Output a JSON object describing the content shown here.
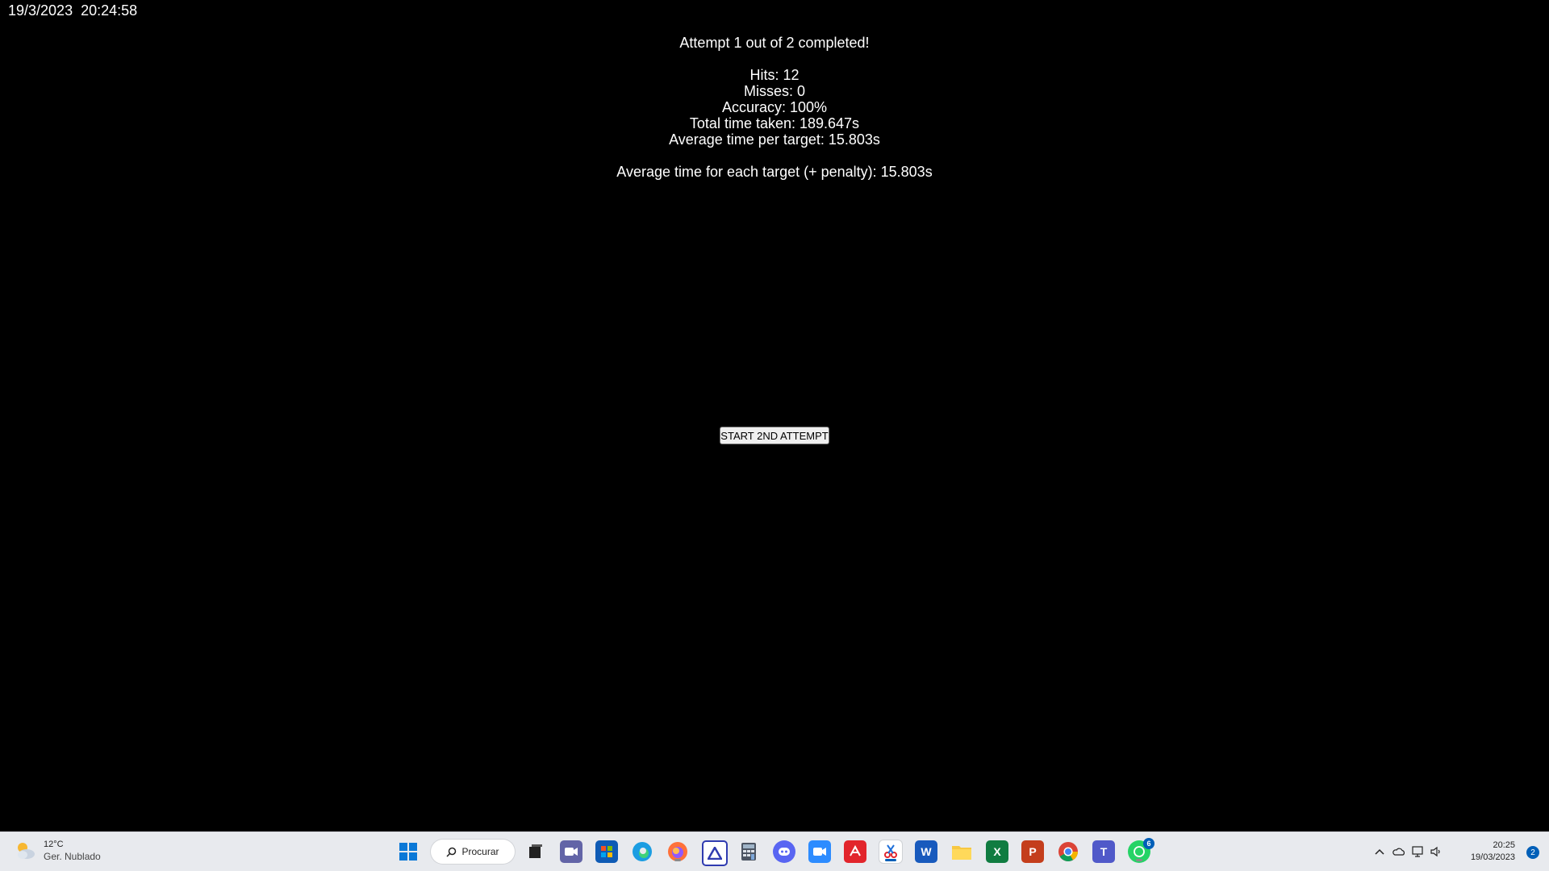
{
  "clock": "19/3/2023  20:24:58",
  "results": {
    "title": "Attempt 1 out of 2 completed!",
    "hits": "Hits: 12",
    "misses": "Misses: 0",
    "accuracy": "Accuracy: 100%",
    "total_time": "Total time taken: 189.647s",
    "avg_time": "Average time per target: 15.803s",
    "avg_penalty": "Average time for each target (+ penalty): 15.803s"
  },
  "button": {
    "label": "START 2ND ATTEMPT"
  },
  "taskbar": {
    "weather": {
      "temp": "12°C",
      "desc": "Ger. Nublado"
    },
    "search_label": "Procurar",
    "whatsapp_badge": "6",
    "time": "20:25",
    "date": "19/03/2023",
    "notifications": "2",
    "apps": [
      {
        "name": "start-icon"
      },
      {
        "name": "task-view-icon"
      },
      {
        "name": "chat-icon"
      },
      {
        "name": "store-icon"
      },
      {
        "name": "edge-icon"
      },
      {
        "name": "firefox-icon"
      },
      {
        "name": "azure-data-studio-icon"
      },
      {
        "name": "calculator-icon"
      },
      {
        "name": "discord-icon"
      },
      {
        "name": "zoom-icon"
      },
      {
        "name": "acrobat-icon"
      },
      {
        "name": "snipping-tool-icon"
      },
      {
        "name": "word-icon"
      },
      {
        "name": "file-explorer-icon"
      },
      {
        "name": "excel-icon"
      },
      {
        "name": "powerpoint-icon"
      },
      {
        "name": "chrome-icon"
      },
      {
        "name": "teams-icon"
      },
      {
        "name": "whatsapp-icon"
      }
    ]
  }
}
